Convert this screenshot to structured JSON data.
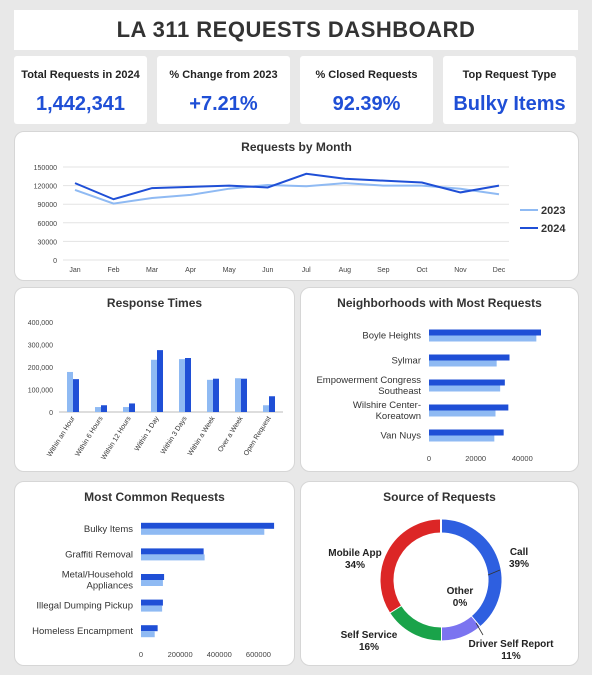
{
  "header": {
    "title": "LA 311 REQUESTS DASHBOARD"
  },
  "kpis": [
    {
      "label": "Total Requests in 2024",
      "value": "1,442,341"
    },
    {
      "label": "% Change from 2023",
      "value": "+7.21%"
    },
    {
      "label": "% Closed Requests",
      "value": "92.39%"
    },
    {
      "label": "Top Request Type",
      "value": "Bulky Items"
    }
  ],
  "colors": {
    "light": "#8fbaf3",
    "dark": "#1f4fd6",
    "accent_value": "#1f4fd6"
  },
  "chart_data": [
    {
      "type": "line",
      "title": "Requests by Month",
      "categories": [
        "Jan",
        "Feb",
        "Mar",
        "Apr",
        "May",
        "Jun",
        "Jul",
        "Aug",
        "Sep",
        "Oct",
        "Nov",
        "Dec"
      ],
      "ylim": [
        0,
        150000
      ],
      "yticks": [
        "0",
        "30000",
        "60000",
        "90000",
        "120000",
        "150000"
      ],
      "yticks_values": [
        0,
        30000,
        60000,
        90000,
        120000,
        150000
      ],
      "grid": true,
      "legend": "right",
      "series": [
        {
          "name": "2023",
          "color": "#8fbaf3",
          "values": [
            113000,
            91000,
            100000,
            105000,
            115000,
            121000,
            119000,
            124000,
            120000,
            120000,
            115000,
            106000
          ]
        },
        {
          "name": "2024",
          "color": "#1f4fd6",
          "values": [
            124000,
            98000,
            116000,
            118000,
            120000,
            117000,
            139000,
            131000,
            128000,
            125000,
            109000,
            120000
          ]
        }
      ]
    },
    {
      "type": "bar",
      "title": "Response Times",
      "categories": [
        "Within an Hour",
        "Within 6 Hours",
        "Within 12 Hours",
        "Within 1 Day",
        "Within 3 Days",
        "Within a Week",
        "Over a Week",
        "Open Request"
      ],
      "ylim": [
        0,
        400000
      ],
      "yticks": [
        "0",
        "100,000",
        "200,000",
        "300,000",
        "400,000"
      ],
      "yticks_values": [
        0,
        100000,
        200000,
        300000,
        400000
      ],
      "series": [
        {
          "color": "#8fbaf3",
          "values": [
            178000,
            22000,
            22000,
            232000,
            235000,
            143000,
            150000,
            30000
          ]
        },
        {
          "color": "#1f4fd6",
          "values": [
            146000,
            30000,
            38000,
            275000,
            240000,
            148000,
            148000,
            70000
          ]
        }
      ]
    },
    {
      "type": "bar",
      "orientation": "horizontal",
      "title": "Neighborhoods with Most Requests",
      "categories": [
        "Boyle Heights",
        "Sylmar",
        "Empowerment Congress Southeast",
        "Wilshire Center-Koreatown",
        "Van Nuys"
      ],
      "category_lines": [
        [
          "Boyle Heights"
        ],
        [
          "Sylmar"
        ],
        [
          "Empowerment Congress",
          "Southeast"
        ],
        [
          "Wilshire Center-",
          "Koreatown"
        ],
        [
          "Van Nuys"
        ]
      ],
      "xlim": [
        0,
        60000
      ],
      "xticks": [
        "0",
        "20000",
        "40000"
      ],
      "xticks_values": [
        0,
        20000,
        40000
      ],
      "series": [
        {
          "color": "#1f4fd6",
          "values": [
            48000,
            34500,
            32500,
            34000,
            32000
          ]
        },
        {
          "color": "#8fbaf3",
          "values": [
            46000,
            29000,
            30500,
            28500,
            28000
          ]
        }
      ]
    },
    {
      "type": "bar",
      "orientation": "horizontal",
      "title": "Most Common Requests",
      "categories": [
        "Bulky Items",
        "Graffiti Removal",
        "Metal/Household Appliances",
        "Illegal Dumping Pickup",
        "Homeless Encampment"
      ],
      "category_lines": [
        [
          "Bulky Items"
        ],
        [
          "Graffiti Removal"
        ],
        [
          "Metal/Household",
          "Appliances"
        ],
        [
          "Illegal Dumping Pickup"
        ],
        [
          "Homeless Encampment"
        ]
      ],
      "xlim": [
        0,
        700000
      ],
      "xticks": [
        "0",
        "200000",
        "400000",
        "600000"
      ],
      "xticks_values": [
        0,
        200000,
        400000,
        600000
      ],
      "series": [
        {
          "color": "#1f4fd6",
          "values": [
            680000,
            320000,
            118000,
            112000,
            85000
          ]
        },
        {
          "color": "#8fbaf3",
          "values": [
            630000,
            325000,
            112000,
            108000,
            70000
          ]
        }
      ]
    },
    {
      "type": "pie",
      "donut": true,
      "title": "Source of Requests",
      "slices": [
        {
          "label": "Call",
          "pct": "39%",
          "value": 39,
          "color": "#2e5fe0"
        },
        {
          "label": "Driver Self Report",
          "pct": "11%",
          "value": 11,
          "color": "#7b74f0"
        },
        {
          "label": "Self Service",
          "pct": "16%",
          "value": 16,
          "color": "#1aa34a"
        },
        {
          "label": "Mobile App",
          "pct": "34%",
          "value": 34,
          "color": "#dc2626"
        },
        {
          "label": "Other",
          "pct": "0%",
          "value": 0,
          "color": "#999999"
        }
      ]
    }
  ]
}
